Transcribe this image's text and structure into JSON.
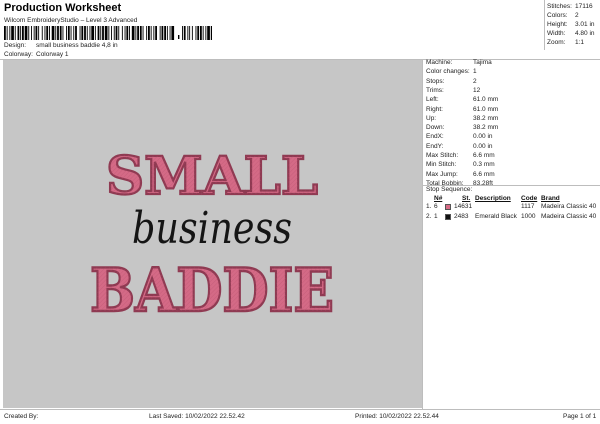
{
  "header": {
    "title": "Production Worksheet",
    "subtitle": "Wilcom EmbroideryStudio – Level 3 Advanced",
    "design_label": "Design:",
    "design_value": "small business baddie 4,8 in",
    "colorway_label": "Colorway:",
    "colorway_value": "Colorway 1"
  },
  "summary": {
    "stitches_label": "Stitches:",
    "stitches_value": "17116",
    "colors_label": "Colors:",
    "colors_value": "2",
    "height_label": "Height:",
    "height_value": "3.01 in",
    "width_label": "Width:",
    "width_value": "4.80 in",
    "zoom_label": "Zoom:",
    "zoom_value": "1:1"
  },
  "details": [
    {
      "label": "Machine:",
      "value": "Tajima"
    },
    {
      "label": "Color changes:",
      "value": "1"
    },
    {
      "label": "Stops:",
      "value": "2"
    },
    {
      "label": "Trims:",
      "value": "12"
    },
    {
      "label": "Left:",
      "value": "61.0 mm"
    },
    {
      "label": "Right:",
      "value": "61.0 mm"
    },
    {
      "label": "Up:",
      "value": "38.2 mm"
    },
    {
      "label": "Down:",
      "value": "38.2 mm"
    },
    {
      "label": "EndX:",
      "value": "0.00 in"
    },
    {
      "label": "EndY:",
      "value": "0.00 in"
    },
    {
      "label": "Max Stitch:",
      "value": "6.6 mm"
    },
    {
      "label": "Min Stitch:",
      "value": "0.3 mm"
    },
    {
      "label": "Max Jump:",
      "value": "6.6 mm"
    },
    {
      "label": "Total Bobbin:",
      "value": "83.28ft"
    }
  ],
  "stop_sequence": {
    "title": "Stop Sequence:",
    "headers": {
      "n": "N#",
      "st": "St.",
      "description": "Description",
      "code": "Code",
      "brand": "Brand"
    },
    "rows": [
      {
        "index": "1.",
        "n": "6",
        "color": "#d86b86",
        "st": "14631",
        "description": "",
        "code": "1117",
        "brand": "Madeira Classic 40"
      },
      {
        "index": "2.",
        "n": "1",
        "color": "#111111",
        "st": "2483",
        "description": "Emerald Black",
        "code": "1000",
        "brand": "Madeira Classic 40"
      }
    ]
  },
  "artwork": {
    "line1": "SMALL",
    "line2": "business",
    "line3": "BADDIE",
    "fill_color": "#d46a86",
    "outline_color": "#8f3a52",
    "script_color": "#151515",
    "background": "#c6c6c6"
  },
  "footer": {
    "created_by": "Created By:",
    "last_saved": "Last Saved: 10/02/2022 22.52.42",
    "printed": "Printed: 10/02/2022 22.52.44",
    "page": "Page 1 of 1"
  }
}
